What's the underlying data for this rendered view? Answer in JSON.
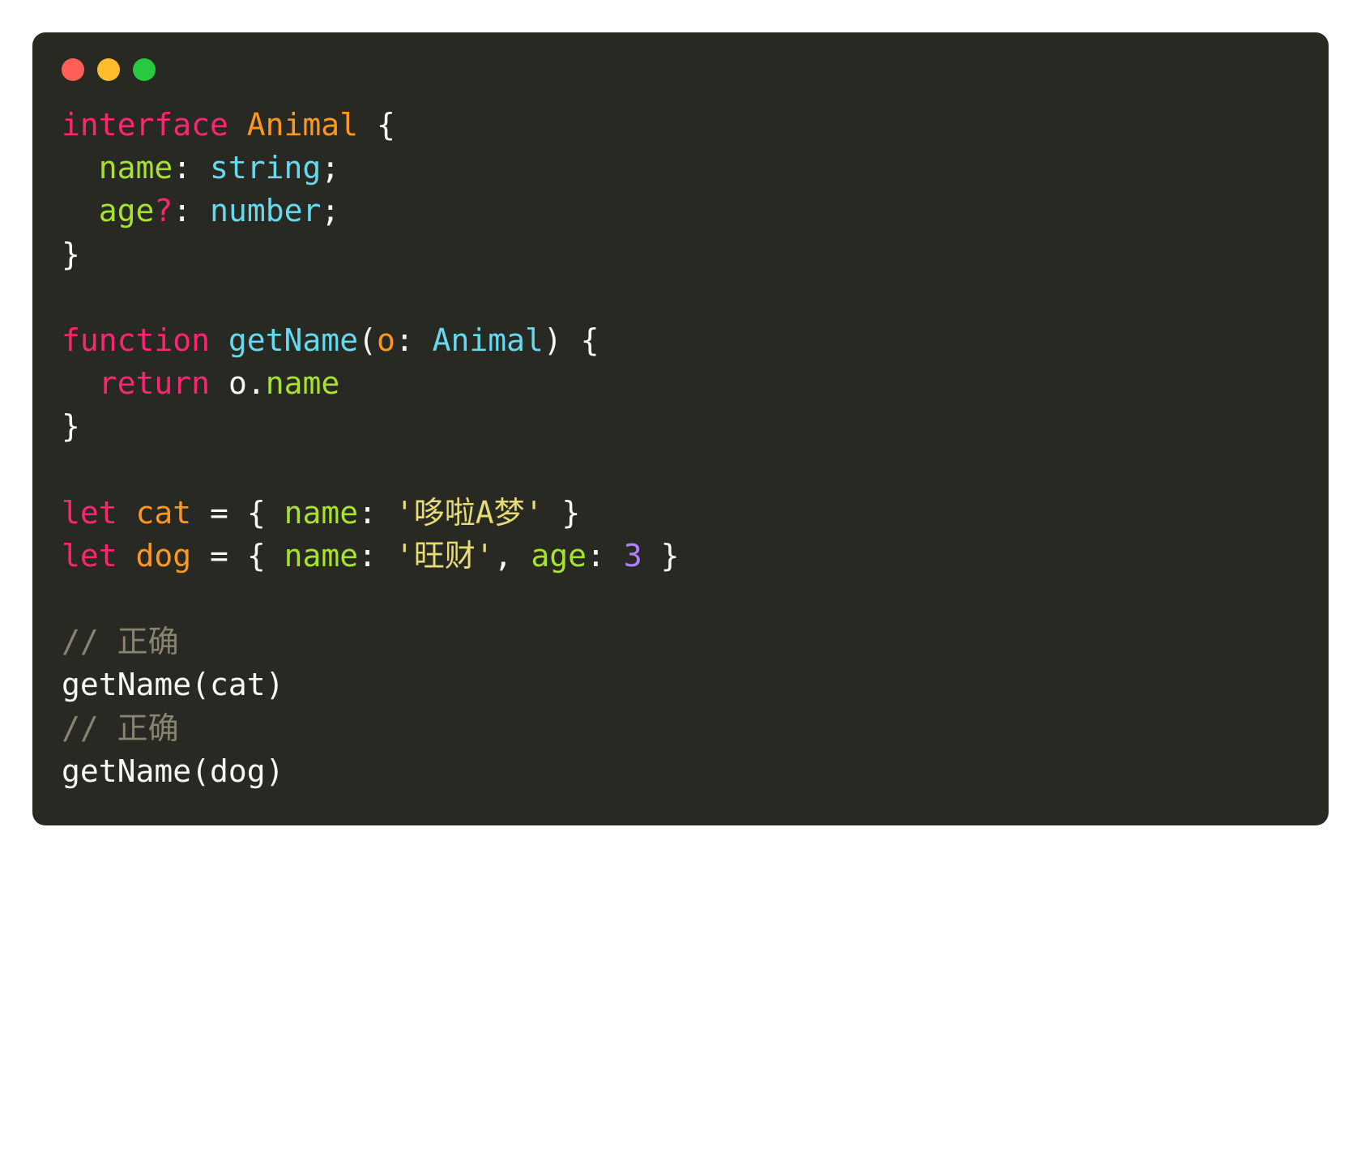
{
  "colors": {
    "traffic_red": "#ff5f56",
    "traffic_yellow": "#ffbd2e",
    "traffic_green": "#27c93f",
    "background": "#282923"
  },
  "code": {
    "line1": {
      "kw_interface": "interface",
      "type_animal": "Animal",
      "brace_open": " {"
    },
    "line2": {
      "indent": "  ",
      "prop_name": "name",
      "colon": ": ",
      "type_string": "string",
      "semi": ";"
    },
    "line3": {
      "indent": "  ",
      "prop_age": "age",
      "question": "?",
      "colon": ": ",
      "type_number": "number",
      "semi": ";"
    },
    "line4": {
      "brace_close": "}"
    },
    "line6": {
      "kw_function": "function",
      "fn_name": "getName",
      "paren_open": "(",
      "param_o": "o",
      "colon": ": ",
      "type_animal": "Animal",
      "paren_close": ")",
      "brace_open": " {"
    },
    "line7": {
      "indent": "  ",
      "kw_return": "return",
      "space": " ",
      "var_o": "o",
      "dot": ".",
      "prop_name": "name"
    },
    "line8": {
      "brace_close": "}"
    },
    "line10": {
      "kw_let": "let",
      "var_cat": "cat",
      "equals": " = ",
      "brace_open": "{ ",
      "prop_name": "name",
      "colon": ": ",
      "str_value": "'哆啦A梦'",
      "brace_close": " }"
    },
    "line11": {
      "kw_let": "let",
      "var_dog": "dog",
      "equals": " = ",
      "brace_open": "{ ",
      "prop_name": "name",
      "colon": ": ",
      "str_value": "'旺财'",
      "comma": ", ",
      "prop_age": "age",
      "colon2": ": ",
      "num_value": "3",
      "brace_close": " }"
    },
    "line13": {
      "comment": "// 正确"
    },
    "line14": {
      "fn_call": "getName",
      "paren_open": "(",
      "arg": "cat",
      "paren_close": ")"
    },
    "line15": {
      "comment": "// 正确"
    },
    "line16": {
      "fn_call": "getName",
      "paren_open": "(",
      "arg": "dog",
      "paren_close": ")"
    }
  }
}
